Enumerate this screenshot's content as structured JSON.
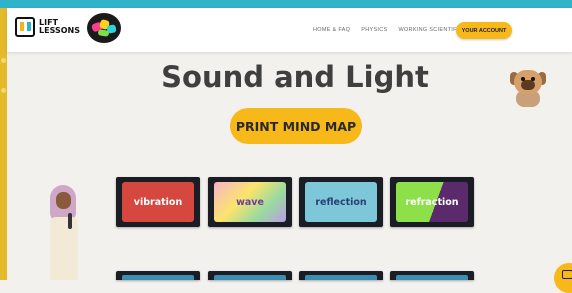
{
  "brand": {
    "logo_text": "LIFT LESSONS"
  },
  "nav": {
    "links": [
      "HOME & FAQ",
      "PHYSICS",
      "WORKING SCIENTIFICALLY"
    ],
    "account_label": "YOUR ACCOUNT"
  },
  "colors": {
    "accent": "#f7b81a",
    "top_bar": "#2fb3c8",
    "left_strip": "#e4ba2a",
    "title": "#3f3f3f"
  },
  "page": {
    "title": "Sound and Light",
    "print_button": "PRINT MIND MAP"
  },
  "cards": [
    {
      "label": "vibration"
    },
    {
      "label": "wave"
    },
    {
      "label": "reflection"
    },
    {
      "label": "refraction"
    }
  ],
  "icons": [
    "lift-lessons-logo-icon",
    "badge-logo-icon",
    "pug-mascot-icon",
    "girl-speaking-icon",
    "chat-icon"
  ]
}
